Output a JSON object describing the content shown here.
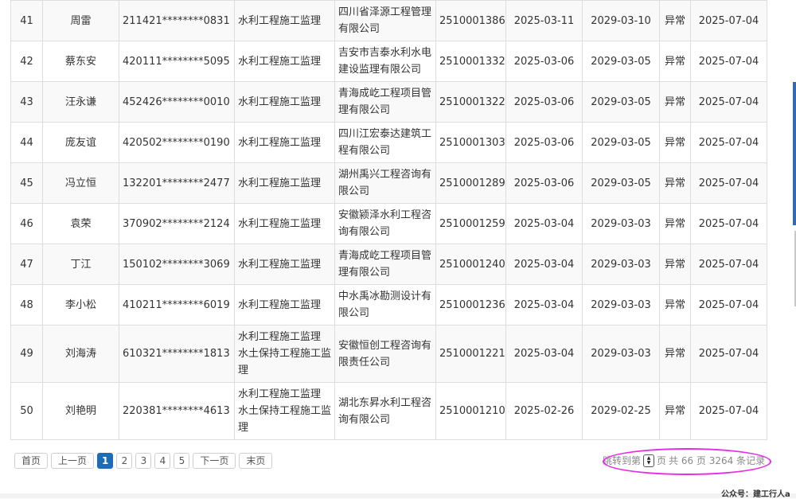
{
  "rows": [
    {
      "no": "41",
      "name": "周雷",
      "id": "211421********0831",
      "major": [
        "水利工程施工监理"
      ],
      "company": [
        "四川省泽源工程管理",
        "有限公司"
      ],
      "cert": "2510001386",
      "start": "2025-03-11",
      "end": "2029-03-10",
      "status": "异常",
      "date": "2025-07-04"
    },
    {
      "no": "42",
      "name": "蔡东安",
      "id": "420111********5095",
      "major": [
        "水利工程施工监理"
      ],
      "company": [
        "吉安市吉泰水利水电",
        "建设监理有限公司"
      ],
      "cert": "2510001332",
      "start": "2025-03-06",
      "end": "2029-03-05",
      "status": "异常",
      "date": "2025-07-04"
    },
    {
      "no": "43",
      "name": "汪永谦",
      "id": "452426********0010",
      "major": [
        "水利工程施工监理"
      ],
      "company": [
        "青海成屹工程项目管",
        "理有限公司"
      ],
      "cert": "2510001322",
      "start": "2025-03-06",
      "end": "2029-03-05",
      "status": "异常",
      "date": "2025-07-04"
    },
    {
      "no": "44",
      "name": "庞友谊",
      "id": "420502********0190",
      "major": [
        "水利工程施工监理"
      ],
      "company": [
        "四川江宏泰达建筑工",
        "程有限公司"
      ],
      "cert": "2510001303",
      "start": "2025-03-06",
      "end": "2029-03-05",
      "status": "异常",
      "date": "2025-07-04"
    },
    {
      "no": "45",
      "name": "冯立恒",
      "id": "132201********2477",
      "major": [
        "水利工程施工监理"
      ],
      "company": [
        "湖州禹兴工程咨询有",
        "限公司"
      ],
      "cert": "2510001289",
      "start": "2025-03-06",
      "end": "2029-03-05",
      "status": "异常",
      "date": "2025-07-04"
    },
    {
      "no": "46",
      "name": "袁荣",
      "id": "370902********2124",
      "major": [
        "水利工程施工监理"
      ],
      "company": [
        "安徽颍泽水利工程咨",
        "询有限公司"
      ],
      "cert": "2510001259",
      "start": "2025-03-04",
      "end": "2029-03-03",
      "status": "异常",
      "date": "2025-07-04"
    },
    {
      "no": "47",
      "name": "丁江",
      "id": "150102********3069",
      "major": [
        "水利工程施工监理"
      ],
      "company": [
        "青海成屹工程项目管",
        "理有限公司"
      ],
      "cert": "2510001240",
      "start": "2025-03-04",
      "end": "2029-03-03",
      "status": "异常",
      "date": "2025-07-04"
    },
    {
      "no": "48",
      "name": "李小松",
      "id": "410211********6019",
      "major": [
        "水利工程施工监理"
      ],
      "company": [
        "中水禹冰勘测设计有",
        "限公司"
      ],
      "cert": "2510001236",
      "start": "2025-03-04",
      "end": "2029-03-03",
      "status": "异常",
      "date": "2025-07-04"
    },
    {
      "no": "49",
      "name": "刘海涛",
      "id": "610321********1813",
      "major": [
        "水利工程施工监理",
        "水土保持工程施工监",
        "理"
      ],
      "company": [
        "安徽恒创工程咨询有",
        "限责任公司"
      ],
      "cert": "2510001221",
      "start": "2025-03-04",
      "end": "2029-03-03",
      "status": "异常",
      "date": "2025-07-04"
    },
    {
      "no": "50",
      "name": "刘艳明",
      "id": "220381********4613",
      "major": [
        "水利工程施工监理",
        "水土保持工程施工监",
        "理"
      ],
      "company": [
        "湖北东昇水利工程咨",
        "询有限公司"
      ],
      "cert": "2510001210",
      "start": "2025-02-26",
      "end": "2029-02-25",
      "status": "异常",
      "date": "2025-07-04"
    }
  ],
  "pagination": {
    "first": "首页",
    "prev": "上一页",
    "pages": [
      "1",
      "2",
      "3",
      "4",
      "5"
    ],
    "active_page": "1",
    "next": "下一页",
    "last": "末页",
    "jump_prefix": "跳转到第",
    "jump_suffix": "页",
    "total_text": "共 66 页 3264 条记录"
  },
  "watermark": "公众号：建工行人a"
}
